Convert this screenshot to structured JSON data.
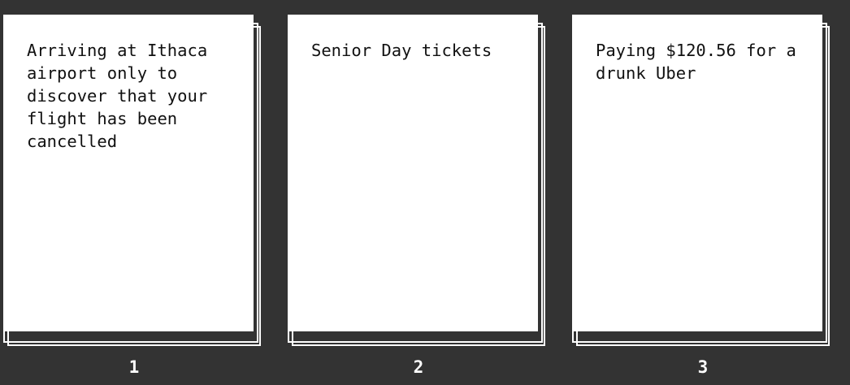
{
  "colors": {
    "background": "#333333",
    "card": "#ffffff",
    "card_text": "#111111",
    "number_text": "#ffffff"
  },
  "cards": [
    {
      "text": "Arriving at Ithaca airport only to discover that your flight has been cancelled",
      "number": "1"
    },
    {
      "text": "Senior Day tickets",
      "number": "2"
    },
    {
      "text": "Paying $120.56 for a drunk Uber",
      "number": "3"
    }
  ]
}
